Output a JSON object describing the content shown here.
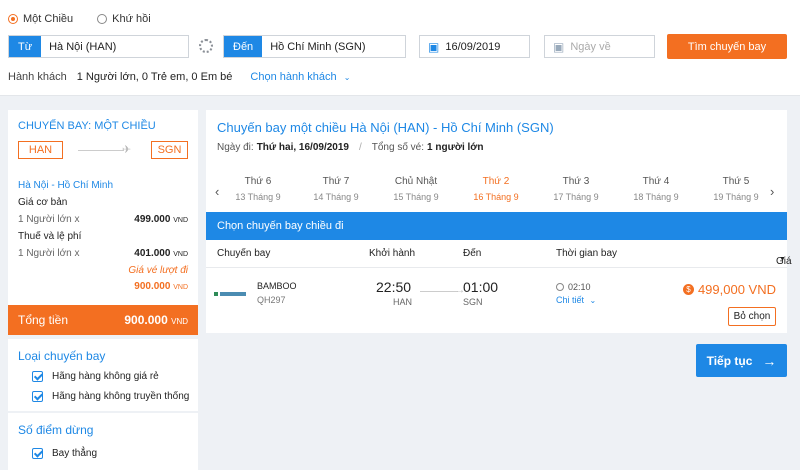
{
  "trip_type": {
    "options": [
      {
        "label": "Một Chiều",
        "selected": true
      },
      {
        "label": "Khứ hồi",
        "selected": false
      }
    ]
  },
  "search": {
    "from_tag": "Từ",
    "from_value": "Hà Nội (HAN)",
    "to_tag": "Đến",
    "to_value": "Hồ Chí Minh (SGN)",
    "depart_date": "16/09/2019",
    "return_placeholder": "Ngày về",
    "search_button": "Tìm chuyến bay",
    "passenger_label": "Hành khách",
    "passenger_value": "1 Người lớn, 0 Trẻ em, 0 Em bé",
    "passenger_link": "Chọn hành khách"
  },
  "summary": {
    "title": "CHUYẾN BAY: MỘT CHIỀU",
    "from_code": "HAN",
    "to_code": "SGN",
    "route": "Hà Nội - Hồ Chí Minh",
    "base_fare_label": "Giá cơ bản",
    "base_fare_pax": "1 Người lớn x",
    "base_fare_value": "499.000",
    "tax_label": "Thuế và lệ phí",
    "tax_pax": "1 Người lớn x",
    "tax_value": "401.000",
    "ticket_note": "Giá vé lượt đi",
    "ticket_total": "900.000",
    "currency": "VND",
    "total_label": "Tổng tiền",
    "total_value": "900.000"
  },
  "filters": {
    "flight_type_title": "Loại chuyến bay",
    "flight_type_options": [
      "Hãng hàng không giá rẻ",
      "Hãng hàng không truyền thống"
    ],
    "stops_title": "Số điểm dừng",
    "stops_options": [
      "Bay thẳng"
    ]
  },
  "main": {
    "title": "Chuyến bay một chiều Hà Nội (HAN) - Hồ Chí Minh (SGN)",
    "date_label": "Ngày đi:",
    "date_value": "Thứ hai, 16/09/2019",
    "pax_label": "Tổng số vé:",
    "pax_value": "1 người lớn",
    "days": [
      {
        "dow": "Thứ 6",
        "date": "13 Tháng 9",
        "active": false
      },
      {
        "dow": "Thứ 7",
        "date": "14 Tháng 9",
        "active": false
      },
      {
        "dow": "Chủ Nhật",
        "date": "15 Tháng 9",
        "active": false
      },
      {
        "dow": "Thứ 2",
        "date": "16 Tháng 9",
        "active": true
      },
      {
        "dow": "Thứ 3",
        "date": "17 Tháng 9",
        "active": false
      },
      {
        "dow": "Thứ 4",
        "date": "18 Tháng 9",
        "active": false
      },
      {
        "dow": "Thứ 5",
        "date": "19 Tháng 9",
        "active": false
      }
    ],
    "select_header": "Chọn chuyến bay chiều đi",
    "columns": {
      "flight": "Chuyến bay",
      "depart": "Khởi hành",
      "arrive": "Đến",
      "duration": "Thời gian bay",
      "price": "Giá"
    },
    "flight": {
      "airline": "BAMBOO",
      "code": "QH297",
      "depart_time": "22:50",
      "depart_airport": "HAN",
      "arrive_time": "01:00",
      "arrive_airport": "SGN",
      "duration": "02:10",
      "detail_link": "Chi tiết",
      "price": "499,000 VND",
      "unselect_button": "Bỏ chọn"
    },
    "continue_button": "Tiếp tục"
  },
  "colors": {
    "accent_blue": "#1e88e5",
    "accent_orange": "#f36f21"
  }
}
